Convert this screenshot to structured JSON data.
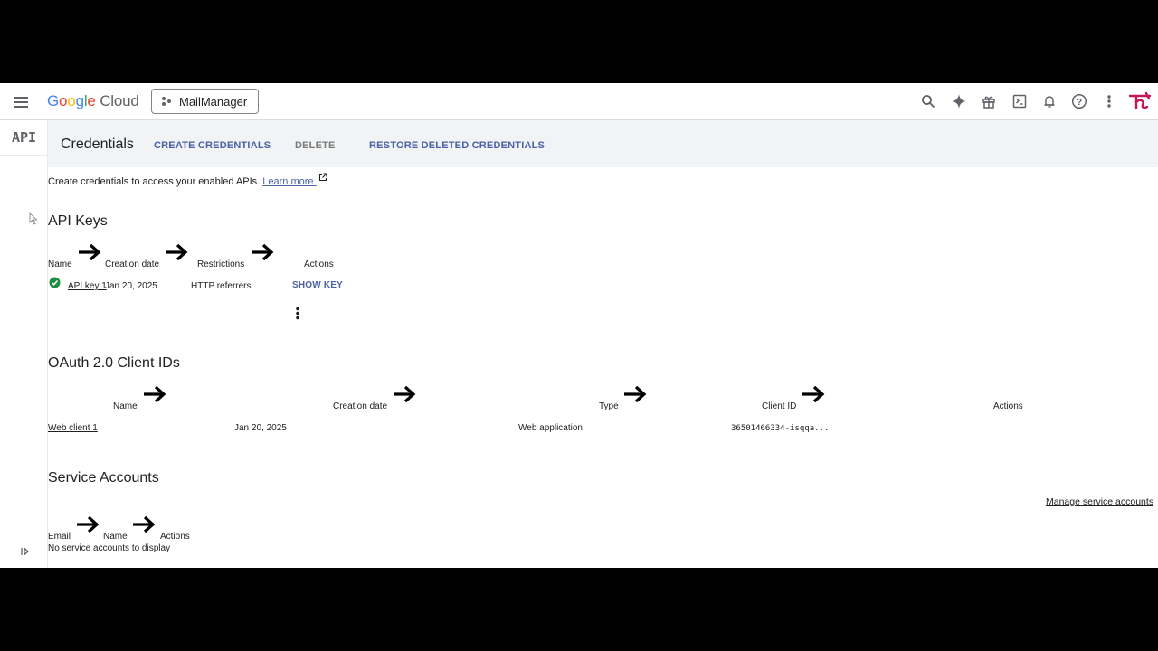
{
  "topbar": {
    "logo": "Google Cloud",
    "logo_colors": [
      "#4285f4",
      "#ea4335",
      "#fbbc05",
      "#4285f4",
      "#34a853",
      "#ea4335"
    ],
    "project": "MailManager",
    "icons": [
      "search-icon",
      "gemini-icon",
      "gift-icon",
      "cloud-shell-icon",
      "notifications-icon",
      "help-icon",
      "more-vert-icon",
      "avatar"
    ]
  },
  "sidebar": {
    "label": "API"
  },
  "actionbar": {
    "title": "Credentials",
    "create": "CREATE CREDENTIALS",
    "delete": "DELETE",
    "restore": "RESTORE DELETED CREDENTIALS"
  },
  "intro": {
    "text": "Create credentials to access your enabled APIs.",
    "learn_more": "Learn more"
  },
  "api_keys": {
    "title": "API Keys",
    "columns": [
      "Name",
      "Creation date",
      "Restrictions",
      "Actions"
    ],
    "rows": [
      {
        "name": "API key 1",
        "created": "Jan 20, 2025",
        "restrictions": "HTTP referrers",
        "action": "SHOW KEY"
      }
    ]
  },
  "oauth": {
    "title": "OAuth 2.0 Client IDs",
    "columns": [
      "Name",
      "Creation date",
      "Type",
      "Client ID",
      "Actions"
    ],
    "rows": [
      {
        "name": "Web client 1",
        "created": "Jan 20, 2025",
        "type": "Web application",
        "client_id": "36501466334-isqqa..."
      }
    ]
  },
  "service_accounts": {
    "title": "Service Accounts",
    "manage": "Manage service accounts",
    "columns": [
      "Email",
      "Name",
      "Actions"
    ],
    "empty": "No service accounts to display"
  },
  "colors": {
    "accent": "#4a61a6",
    "visited_link": "#681da8",
    "success": "#1e8e3e",
    "avatar": "#c2185b"
  }
}
